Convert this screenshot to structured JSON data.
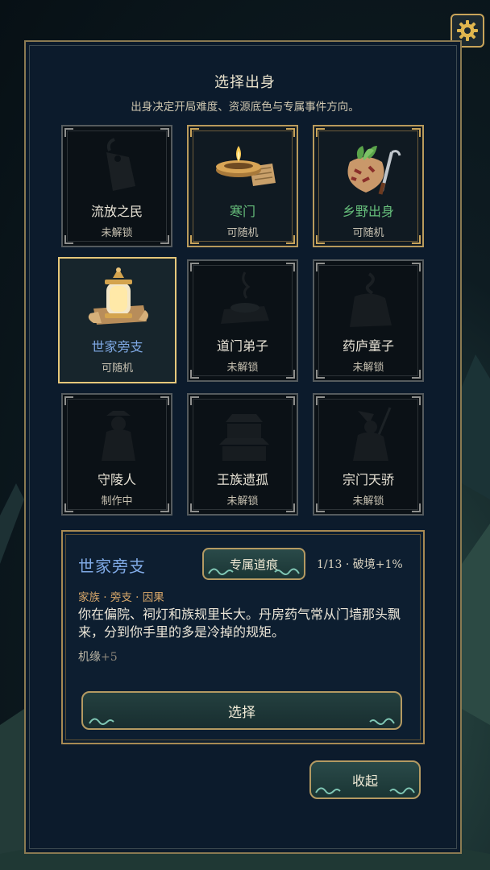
{
  "header": {
    "title": "选择出身",
    "subtitle": "出身决定开局难度、资源底色与专属事件方向。"
  },
  "origins": [
    {
      "name": "流放之民",
      "status": "未解锁",
      "icon": "hanging-tag-silhouette"
    },
    {
      "name": "寒门",
      "status": "可随机",
      "icon": "oil-lamp-scroll"
    },
    {
      "name": "乡野出身",
      "status": "可随机",
      "icon": "herb-sack-sickle"
    },
    {
      "name": "世家旁支",
      "status": "可随机",
      "icon": "lantern-scrolls"
    },
    {
      "name": "道门弟子",
      "status": "未解锁",
      "icon": "incense-burner-silhouette"
    },
    {
      "name": "药庐童子",
      "status": "未解锁",
      "icon": "medicine-pot-silhouette"
    },
    {
      "name": "守陵人",
      "status": "制作中",
      "icon": "hooded-figure-silhouette"
    },
    {
      "name": "王族遗孤",
      "status": "未解锁",
      "icon": "palace-silhouette"
    },
    {
      "name": "宗门天骄",
      "status": "未解锁",
      "icon": "sword-cultivator-silhouette"
    }
  ],
  "detail": {
    "name": "世家旁支",
    "tag_button": "专属道痕",
    "progress": "1/13 · 破境+1%",
    "tags": "家族 · 旁支 · 因果",
    "description": "你在偏院、祠灯和族规里长大。丹房药气常从门墙那头飘来，分到你手里的多是冷掉的规矩。",
    "bonus_label": "机缘",
    "bonus_value": "+5",
    "select_button": "选择"
  },
  "footer": {
    "collapse_button": "收起"
  },
  "colors": {
    "gold_border": "#b49a62",
    "selected_name": "#7fa9e4",
    "unlocked_name": "#67c07c",
    "tag_orange": "#d9a86a",
    "panel_bg": "#0c1b2c"
  }
}
